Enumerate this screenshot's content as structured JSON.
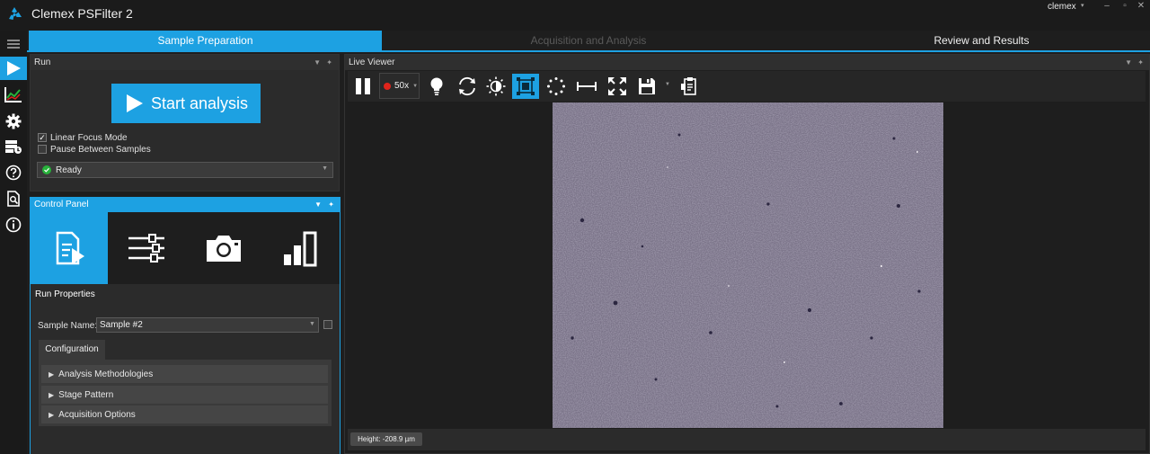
{
  "app": {
    "title": "Clemex PSFilter 2",
    "user": "clemex",
    "accent_color": "#1da1e2"
  },
  "window_controls": {
    "caret": "▾",
    "minimize": "–",
    "maximize": "▫",
    "close": "✕"
  },
  "rail": {
    "items": [
      "menu-icon",
      "play-icon",
      "chart-icon",
      "gear-icon",
      "database-icon",
      "help-icon",
      "report-icon",
      "info-icon"
    ],
    "active": "play-icon"
  },
  "tabs": [
    {
      "label": "Sample Preparation",
      "state": "active"
    },
    {
      "label": "Acquisition and Analysis",
      "state": "disabled"
    },
    {
      "label": "Review and Results",
      "state": "normal"
    }
  ],
  "run_panel": {
    "title": "Run",
    "start_label": "Start analysis",
    "options": [
      {
        "label": "Linear Focus Mode",
        "checked": true
      },
      {
        "label": "Pause Between Samples",
        "checked": false
      }
    ],
    "status": {
      "label": "Ready",
      "color": "#27b33b"
    }
  },
  "control_panel": {
    "title": "Control Panel",
    "icons": [
      "run-properties-icon",
      "settings-sliders-icon",
      "camera-icon",
      "bar-chart-icon"
    ],
    "active_label": "Run Properties",
    "sample_name_label": "Sample Name:",
    "sample_name_value": "Sample #2",
    "config_tab": "Configuration",
    "sections": [
      "Analysis Methodologies",
      "Stage Pattern",
      "Acquisition Options"
    ]
  },
  "viewer": {
    "title": "Live Viewer",
    "magnification": "50x",
    "record_color": "#e0241b",
    "tools": [
      "pause-icon",
      "record-magnification-select",
      "lightbulb-icon",
      "refresh-icon",
      "brightness-icon",
      "crop-icon",
      "focus-dots-icon",
      "measure-icon",
      "fullscreen-icon",
      "save-icon",
      "clipboard-icon"
    ],
    "active_tool": "crop-icon",
    "height_readout": "Height: -208.9 µm"
  }
}
